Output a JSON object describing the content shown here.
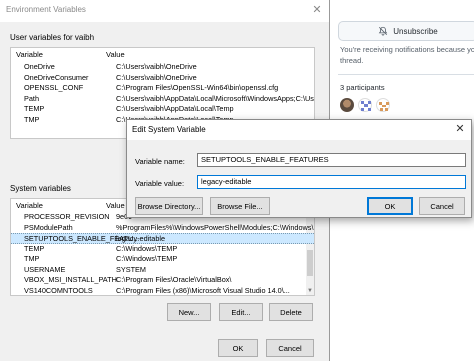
{
  "github": {
    "unsubscribe_label": "Unsubscribe",
    "notification_text": "You're receiving notifications because you",
    "notification_text_2": "thread.",
    "participants_label": "3 participants"
  },
  "env_dialog": {
    "title": "Environment Variables",
    "user_section_label": "User variables for vaibh",
    "user_headers": {
      "name": "Variable",
      "value": "Value"
    },
    "user_vars": [
      {
        "name": "OneDrive",
        "value": "C:\\Users\\vaibh\\OneDrive"
      },
      {
        "name": "OneDriveConsumer",
        "value": "C:\\Users\\vaibh\\OneDrive"
      },
      {
        "name": "OPENSSL_CONF",
        "value": "C:\\Program Files\\OpenSSL-Win64\\bin\\openssl.cfg"
      },
      {
        "name": "Path",
        "value": "C:\\Users\\vaibh\\AppData\\Local\\Microsoft\\WindowsApps;C:\\Us..."
      },
      {
        "name": "TEMP",
        "value": "C:\\Users\\vaibh\\AppData\\Local\\Temp"
      },
      {
        "name": "TMP",
        "value": "C:\\Users\\vaibh\\AppData\\Local\\Temp"
      }
    ],
    "system_section_label": "System variables",
    "system_headers": {
      "name": "Variable",
      "value": "Value"
    },
    "system_vars": [
      {
        "name": "PROCESSOR_REVISION",
        "value": "9e09"
      },
      {
        "name": "PSModulePath",
        "value": "%ProgramFiles%\\WindowsPowerShell\\Modules;C:\\Windows\\..."
      },
      {
        "name": "SETUPTOOLS_ENABLE_FEATU...",
        "value": "legacy-editable",
        "selected": true
      },
      {
        "name": "TEMP",
        "value": "C:\\Windows\\TEMP"
      },
      {
        "name": "TMP",
        "value": "C:\\Windows\\TEMP"
      },
      {
        "name": "USERNAME",
        "value": "SYSTEM"
      },
      {
        "name": "VBOX_MSI_INSTALL_PATH",
        "value": "C:\\Program Files\\Oracle\\VirtualBox\\"
      },
      {
        "name": "VS140COMNTOOLS",
        "value": "C:\\Program Files (x86)\\Microsoft Visual Studio 14.0\\..."
      }
    ],
    "buttons": {
      "new": "New...",
      "edit": "Edit...",
      "delete": "Delete",
      "ok": "OK",
      "cancel": "Cancel"
    }
  },
  "edit_dialog": {
    "title": "Edit System Variable",
    "name_label": "Variable name:",
    "name_value": "SETUPTOOLS_ENABLE_FEATURES",
    "value_label": "Variable value:",
    "value_value": "legacy-editable",
    "buttons": {
      "browse_directory": "Browse Directory...",
      "browse_file": "Browse File...",
      "ok": "OK",
      "cancel": "Cancel"
    }
  },
  "colors": {
    "accent": "#0078d7",
    "selection": "#cce8ff",
    "dialog_bg": "#f0f0f0"
  }
}
